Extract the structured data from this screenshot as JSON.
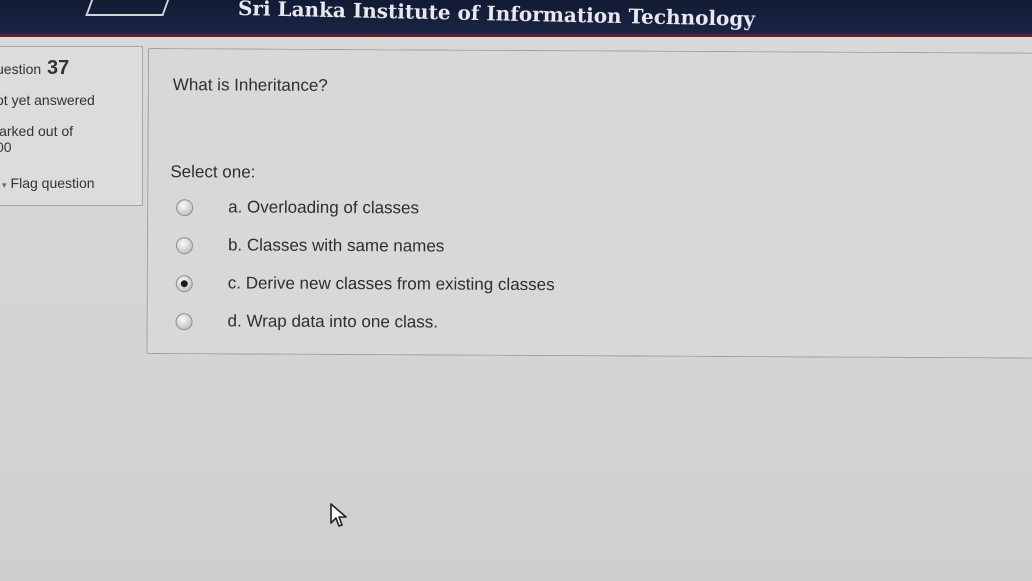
{
  "header": {
    "title": "Sri Lanka Institute of Information Technology"
  },
  "info": {
    "question_label": "uestion",
    "question_number": "37",
    "state": "ot yet answered",
    "marked_label": "larked out of",
    "marked_value": "00",
    "flag_label": "Flag question",
    "flag_icon": "flag-icon"
  },
  "question": {
    "text": "What is Inheritance?",
    "select_label": "Select one:",
    "selected_index": 2,
    "options": [
      {
        "label": "a. Overloading of classes"
      },
      {
        "label": "b. Classes with same names"
      },
      {
        "label": "c. Derive new classes from existing classes"
      },
      {
        "label": "d. Wrap data into one class."
      }
    ]
  },
  "colors": {
    "header_bg": "#121b33",
    "header_accent": "#6a1f25",
    "page_bg": "#d9d9d9"
  }
}
